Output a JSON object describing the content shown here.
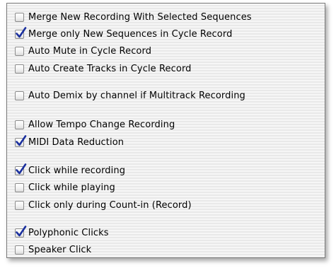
{
  "options": [
    {
      "label": "Merge New Recording With Selected Sequences",
      "checked": false
    },
    {
      "label": "Merge only New Sequences in Cycle Record",
      "checked": true
    },
    {
      "label": "Auto Mute in Cycle Record",
      "checked": false
    },
    {
      "label": "Auto Create Tracks in Cycle Record",
      "checked": false
    },
    {
      "label": "Auto Demix by channel if Multitrack Recording",
      "checked": false
    },
    {
      "label": "Allow Tempo Change Recording",
      "checked": false
    },
    {
      "label": "MIDI Data Reduction",
      "checked": true
    },
    {
      "label": "Click while recording",
      "checked": true
    },
    {
      "label": "Click while playing",
      "checked": false
    },
    {
      "label": "Click only during Count-in (Record)",
      "checked": false
    },
    {
      "label": "Polyphonic Clicks",
      "checked": true
    },
    {
      "label": "Speaker Click",
      "checked": false
    }
  ],
  "colors": {
    "checkmark": "#1a2f9e",
    "border": "#7a7a7a"
  }
}
